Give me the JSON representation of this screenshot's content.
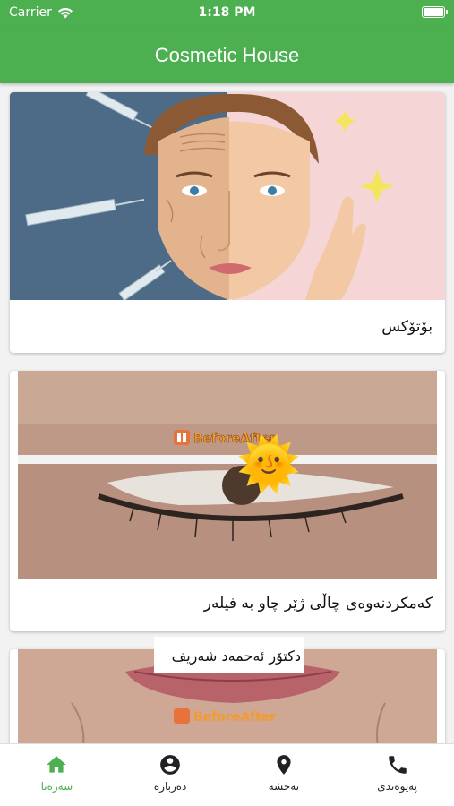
{
  "status_bar": {
    "carrier": "Carrier",
    "time": "1:18 PM",
    "wifi_icon": "wifi-icon",
    "battery_icon": "battery-icon"
  },
  "app_bar": {
    "title": "Cosmetic House"
  },
  "cards": [
    {
      "caption": "بۆتۆکس",
      "image": "botox-face-illustration"
    },
    {
      "caption": "کەمکردنەوەی چاڵی ژێر چاو بە فیلەر",
      "image": "under-eye-before-after",
      "watermark": "BeforeAfter",
      "emoji": "🌞"
    },
    {
      "caption": "دکتۆر ئەحمەد شەریف",
      "image": "lips-before-after",
      "watermark": "BeforeAfter"
    }
  ],
  "bottom_nav": {
    "items": [
      {
        "label": "سەرەتا",
        "icon": "home-icon",
        "active": true
      },
      {
        "label": "دەربارە",
        "icon": "account-circle-icon",
        "active": false
      },
      {
        "label": "نەخشە",
        "icon": "location-pin-icon",
        "active": false
      },
      {
        "label": "پەیوەندی",
        "icon": "phone-icon",
        "active": false
      }
    ]
  },
  "colors": {
    "primary": "#4caf50",
    "background": "#f2f2f2"
  }
}
